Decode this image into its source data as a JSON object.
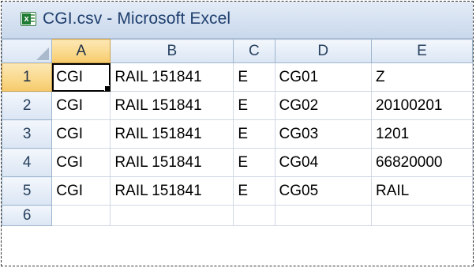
{
  "window": {
    "title": "CGI.csv - Microsoft Excel",
    "app_icon": "excel-icon"
  },
  "sheet": {
    "columns": [
      "A",
      "B",
      "C",
      "D",
      "E"
    ],
    "rows": [
      {
        "num": "1",
        "cells": [
          "CGI",
          "RAIL 151841",
          "E",
          "CG01",
          "Z"
        ]
      },
      {
        "num": "2",
        "cells": [
          "CGI",
          "RAIL 151841",
          "E",
          "CG02",
          "20100201"
        ]
      },
      {
        "num": "3",
        "cells": [
          "CGI",
          "RAIL 151841",
          "E",
          "CG03",
          "1201"
        ]
      },
      {
        "num": "4",
        "cells": [
          "CGI",
          "RAIL 151841",
          "E",
          "CG04",
          "66820000"
        ]
      },
      {
        "num": "5",
        "cells": [
          "CGI",
          "RAIL 151841",
          "E",
          "CG05",
          "RAIL"
        ]
      },
      {
        "num": "6",
        "cells": [
          "",
          "",
          "",
          "",
          ""
        ]
      }
    ],
    "active_cell": "A1",
    "colors": {
      "title_text": "#1f3f6e",
      "active_header": "#f9d88a",
      "gridline": "#d0d7e5"
    }
  }
}
